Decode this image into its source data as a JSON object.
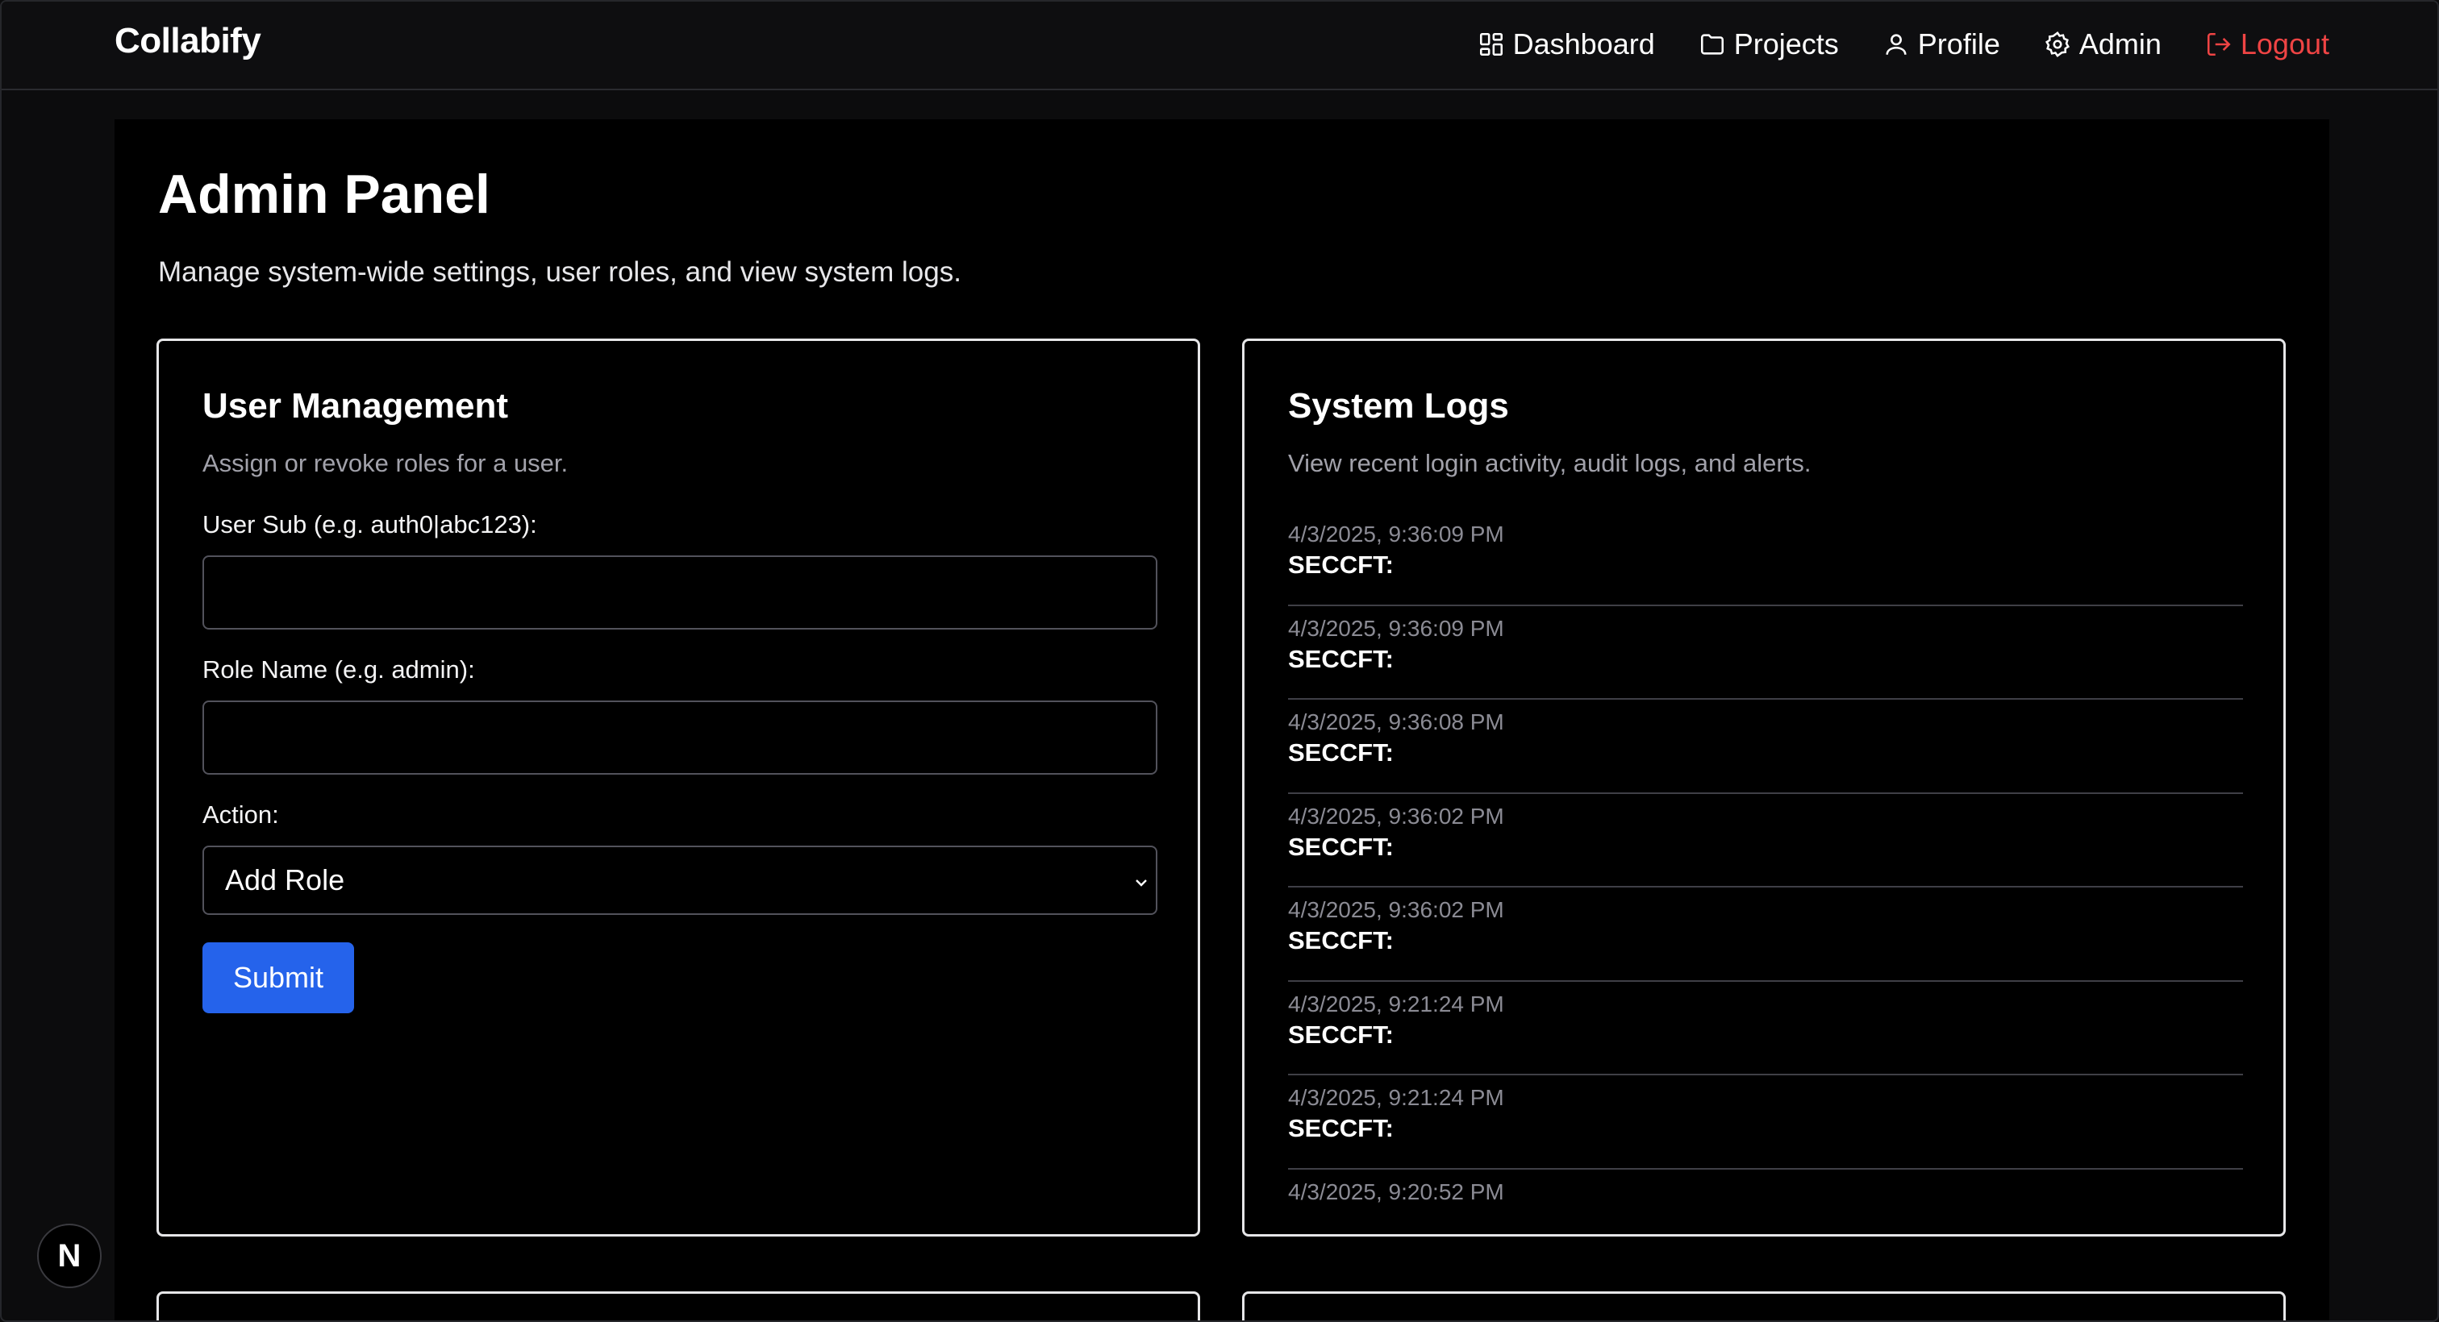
{
  "brand": "Collabify",
  "nav": {
    "dashboard": "Dashboard",
    "projects": "Projects",
    "profile": "Profile",
    "admin": "Admin",
    "logout": "Logout"
  },
  "page": {
    "title": "Admin Panel",
    "description": "Manage system-wide settings, user roles, and view system logs."
  },
  "user_management": {
    "title": "User Management",
    "description": "Assign or revoke roles for a user.",
    "user_sub_label": "User Sub (e.g. auth0|abc123):",
    "user_sub_value": "",
    "role_name_label": "Role Name (e.g. admin):",
    "role_name_value": "",
    "action_label": "Action:",
    "action_selected": "Add Role",
    "submit_label": "Submit"
  },
  "system_logs": {
    "title": "System Logs",
    "description": "View recent login activity, audit logs, and alerts.",
    "entries": [
      {
        "time": "4/3/2025, 9:36:09 PM",
        "event": "SECCFT:"
      },
      {
        "time": "4/3/2025, 9:36:09 PM",
        "event": "SECCFT:"
      },
      {
        "time": "4/3/2025, 9:36:08 PM",
        "event": "SECCFT:"
      },
      {
        "time": "4/3/2025, 9:36:02 PM",
        "event": "SECCFT:"
      },
      {
        "time": "4/3/2025, 9:36:02 PM",
        "event": "SECCFT:"
      },
      {
        "time": "4/3/2025, 9:21:24 PM",
        "event": "SECCFT:"
      },
      {
        "time": "4/3/2025, 9:21:24 PM",
        "event": "SECCFT:"
      },
      {
        "time": "4/3/2025, 9:20:52 PM",
        "event": ""
      }
    ]
  },
  "next_badge": "N",
  "colors": {
    "accent": "#2563eb",
    "logout": "#ef4444",
    "background": "#000000"
  },
  "icons": {
    "dashboard": "layout-grid-icon",
    "projects": "folder-icon",
    "profile": "user-icon",
    "admin": "gear-icon",
    "logout": "logout-icon",
    "select": "chevron-down-icon"
  }
}
